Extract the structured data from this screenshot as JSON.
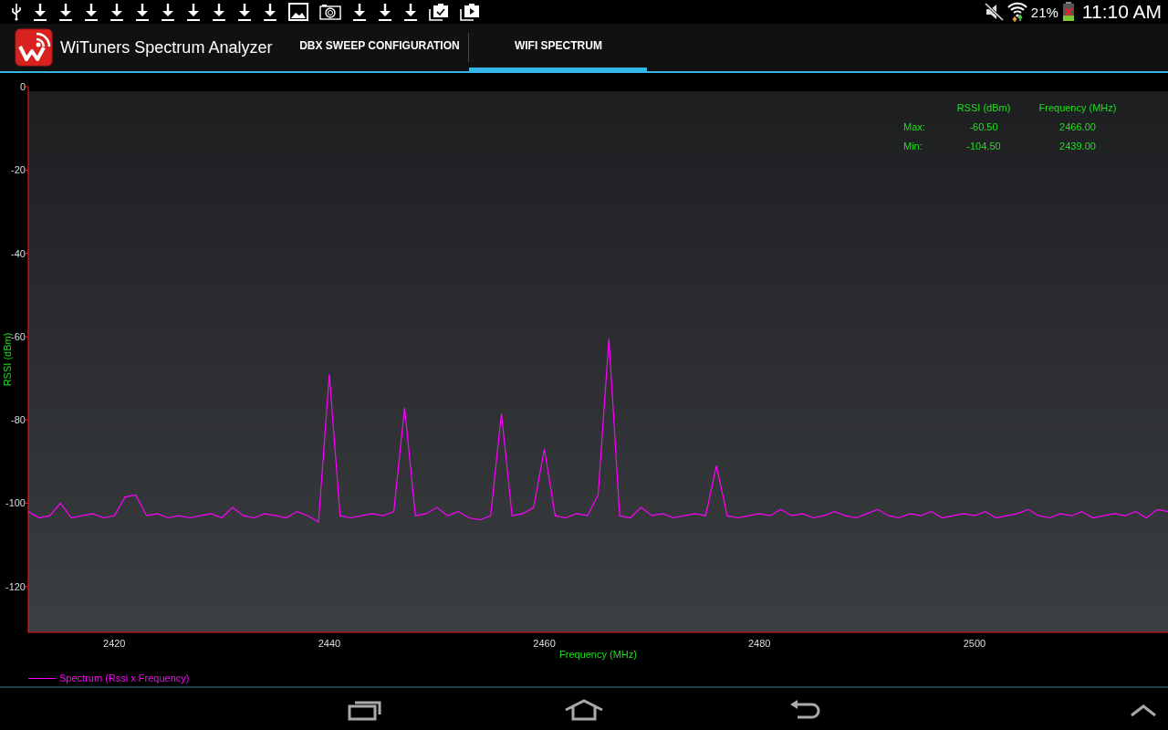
{
  "status_bar": {
    "battery": "21%",
    "time": "11:10 AM"
  },
  "app_bar": {
    "title": "WiTuners Spectrum Analyzer"
  },
  "tabs": [
    {
      "label": "DBX SWEEP CONFIGURATION",
      "selected": false
    },
    {
      "label": "WIFI SPECTRUM",
      "selected": true
    }
  ],
  "stats": {
    "columns": [
      "RSSI (dBm)",
      "Frequency (MHz)"
    ],
    "rows": [
      {
        "label": "Max:",
        "rssi": "-60.50",
        "frequency": "2466.00"
      },
      {
        "label": "Min:",
        "rssi": "-104.50",
        "frequency": "2439.00"
      }
    ]
  },
  "chart": {
    "chart_data": {
      "type": "line",
      "xlabel": "Frequency (MHz)",
      "ylabel": "RSSI (dBm)",
      "xlim": [
        2412,
        2518
      ],
      "ylim": [
        -131,
        0
      ],
      "xticks": [
        2420,
        2440,
        2460,
        2480,
        2500
      ],
      "yticks": [
        0,
        -20,
        -40,
        -60,
        -80,
        -100,
        -120
      ],
      "x": [
        2412,
        2413,
        2414,
        2415,
        2416,
        2417,
        2418,
        2419,
        2420,
        2421,
        2422,
        2423,
        2424,
        2425,
        2426,
        2427,
        2428,
        2429,
        2430,
        2431,
        2432,
        2433,
        2434,
        2435,
        2436,
        2437,
        2438,
        2439,
        2440,
        2441,
        2442,
        2443,
        2444,
        2445,
        2446,
        2447,
        2448,
        2449,
        2450,
        2451,
        2452,
        2453,
        2454,
        2455,
        2456,
        2457,
        2458,
        2459,
        2460,
        2461,
        2462,
        2463,
        2464,
        2465,
        2466,
        2467,
        2468,
        2469,
        2470,
        2471,
        2472,
        2473,
        2474,
        2475,
        2476,
        2477,
        2478,
        2479,
        2480,
        2481,
        2482,
        2483,
        2484,
        2485,
        2486,
        2487,
        2488,
        2489,
        2490,
        2491,
        2492,
        2493,
        2494,
        2495,
        2496,
        2497,
        2498,
        2499,
        2500,
        2501,
        2502,
        2503,
        2504,
        2505,
        2506,
        2507,
        2508,
        2509,
        2510,
        2511,
        2512,
        2513,
        2514,
        2515,
        2516,
        2517,
        2518
      ],
      "series": [
        {
          "name": "Spectrum (Rssi x Frequency)",
          "color": "#ff00ff",
          "values": [
            -102,
            -103.5,
            -103,
            -100,
            -103.5,
            -103,
            -102.5,
            -103.5,
            -103,
            -98.5,
            -98,
            -103,
            -102.5,
            -103.5,
            -103,
            -103.5,
            -103,
            -102.5,
            -103.5,
            -101,
            -103,
            -103.5,
            -102.5,
            -103,
            -103.5,
            -102,
            -103,
            -104.5,
            -69,
            -103,
            -103.5,
            -103,
            -102.5,
            -103,
            -102,
            -77,
            -103,
            -102.5,
            -101,
            -103,
            -102,
            -103.5,
            -104,
            -103,
            -78.5,
            -103,
            -102.5,
            -101,
            -87,
            -103,
            -103.5,
            -102.5,
            -103,
            -98,
            -60.5,
            -103,
            -103.5,
            -101,
            -103,
            -102.5,
            -103.5,
            -103,
            -102.5,
            -103,
            -91,
            -103,
            -103.5,
            -103,
            -102.5,
            -103,
            -101.5,
            -103,
            -102.5,
            -103.5,
            -103,
            -102,
            -103,
            -103.5,
            -102.5,
            -101.5,
            -103,
            -103.5,
            -102.5,
            -103,
            -102,
            -103.5,
            -103,
            -102.5,
            -103,
            -102,
            -103.5,
            -103,
            -102.5,
            -101.5,
            -103,
            -103.5,
            -102.5,
            -103,
            -102,
            -103.5,
            -103,
            -102.5,
            -103,
            -102,
            -103.5,
            -101.5,
            -102
          ]
        }
      ]
    }
  }
}
